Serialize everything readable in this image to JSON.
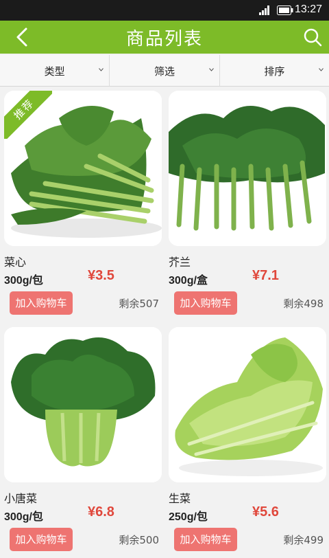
{
  "status_bar": {
    "time": "13:27"
  },
  "header": {
    "title": "商品列表"
  },
  "filters": [
    {
      "label": "类型"
    },
    {
      "label": "筛选"
    },
    {
      "label": "排序"
    }
  ],
  "colors": {
    "accent": "#7dbb28",
    "price": "#e0483c",
    "cart_button": "#ee7471"
  },
  "products": [
    {
      "name": "菜心",
      "spec": "300g/包",
      "price": "¥3.5",
      "cart_label": "加入购物车",
      "stock": "剩余507",
      "badge": "推荐",
      "image_icon": "choy-sum-photo"
    },
    {
      "name": "芥兰",
      "spec": "300g/盒",
      "price": "¥7.1",
      "cart_label": "加入购物车",
      "stock": "剩余498",
      "image_icon": "kai-lan-photo"
    },
    {
      "name": "小唐菜",
      "spec": "300g/包",
      "price": "¥6.8",
      "cart_label": "加入购物车",
      "stock": "剩余500",
      "image_icon": "bok-choy-photo"
    },
    {
      "name": "生菜",
      "spec": "250g/包",
      "price": "¥5.6",
      "cart_label": "加入购物车",
      "stock": "剩余499",
      "image_icon": "lettuce-photo"
    }
  ]
}
